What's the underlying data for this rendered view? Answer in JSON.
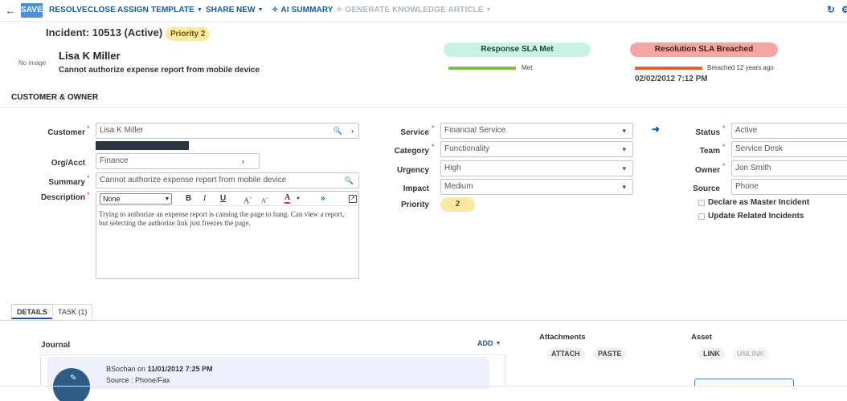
{
  "toolbar": {
    "save": "SAVE",
    "resolve": "RESOLVE",
    "close": "CLOSE",
    "assign": "ASSIGN",
    "template": "TEMPLATE",
    "share": "SHARE",
    "new": "NEW",
    "ai_summary": "AI SUMMARY",
    "generate_ka": "GENERATE KNOWLEDGE ARTICLE"
  },
  "header": {
    "title": "Incident: 10513 (Active)",
    "priority_badge": "Priority 2",
    "no_image": "No image",
    "customer_name": "Lisa K Miller",
    "subject": "Cannot authorize expense report from mobile device"
  },
  "sla": {
    "response_label": "Response SLA Met",
    "response_status": "Met",
    "resolution_label": "Resolution SLA Breached",
    "resolution_status": "Breached 12 years ago",
    "resolution_date": "02/02/2012 7:12 PM",
    "colors": {
      "met": "#7bc143",
      "breached": "#e8602c"
    }
  },
  "section": {
    "title": "CUSTOMER & OWNER"
  },
  "form": {
    "customer_label": "Customer",
    "customer_value": "Lisa K Miller",
    "org_label": "Org/Acct",
    "org_value": "Finance",
    "summary_label": "Summary",
    "summary_value": "Cannot authorize expense report from mobile device",
    "description_label": "Description",
    "description_format": "None",
    "description_text": "Trying to authorize an expense report is causing the page to hang.  Can view a report, but selecting the authorize link just freezes the page.",
    "service_label": "Service",
    "service_value": "Financial Service",
    "category_label": "Category",
    "category_value": "Functionality",
    "urgency_label": "Urgency",
    "urgency_value": "High",
    "impact_label": "Impact",
    "impact_value": "Medium",
    "priority_label": "Priority",
    "priority_value": "2",
    "status_label": "Status",
    "status_value": "Active",
    "team_label": "Team",
    "team_value": "Service Desk",
    "owner_label": "Owner",
    "owner_value": "Jon Smith",
    "source_label": "Source",
    "source_value": "Phone",
    "master_incident": "Declare as Master Incident",
    "update_related": "Update Related Incidents"
  },
  "tabs": [
    {
      "label": "DETAILS"
    },
    {
      "label": "TASK (1)"
    }
  ],
  "journal": {
    "title": "Journal",
    "add": "ADD",
    "entry_author": "BSochan",
    "entry_on": "on",
    "entry_date": "11/01/2012 7:25 PM",
    "entry_source": "Source : Phone/Fax"
  },
  "attachments": {
    "title": "Attachments",
    "attach": "ATTACH",
    "paste": "PASTE"
  },
  "asset": {
    "title": "Asset",
    "link": "LINK",
    "unlink": "UNLINK"
  }
}
